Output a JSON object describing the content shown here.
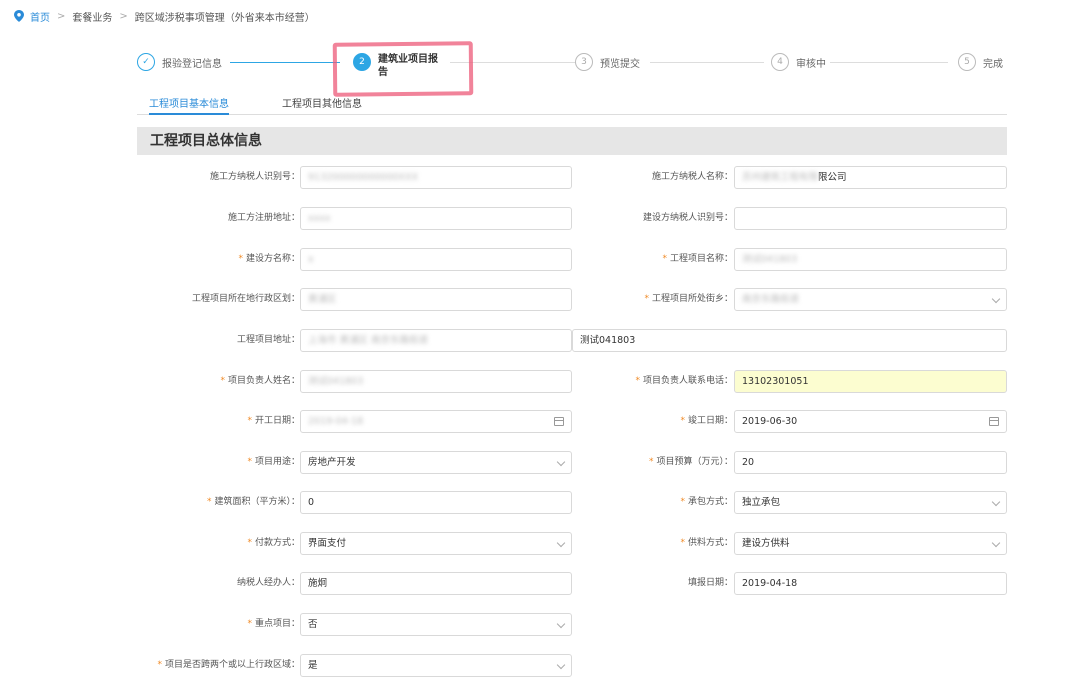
{
  "breadcrumb": {
    "items": [
      "首页",
      "套餐业务",
      "跨区域涉税事项管理（外省来本市经营）"
    ],
    "separator": ">"
  },
  "steps": [
    {
      "num": "✓",
      "label": "报验登记信息",
      "state": "done"
    },
    {
      "num": "2",
      "label": "建筑业项目报告",
      "state": "active"
    },
    {
      "num": "3",
      "label": "预览提交",
      "state": "pending"
    },
    {
      "num": "4",
      "label": "审核中",
      "state": "pending"
    },
    {
      "num": "5",
      "label": "完成",
      "state": "pending"
    }
  ],
  "tabs": [
    {
      "label": "工程项目基本信息",
      "active": true
    },
    {
      "label": "工程项目其他信息",
      "active": false
    }
  ],
  "section_title": "工程项目总体信息",
  "form": {
    "contractor_tax_id": {
      "label": "施工方纳税人识别号：",
      "value": "913200000000000XXX"
    },
    "contractor_name": {
      "label": "施工方纳税人名称：",
      "value_blur": "苏州建筑工程有限",
      "value_tail": "限公司"
    },
    "contractor_address": {
      "label": "施工方注册地址：",
      "value": "xxxx"
    },
    "builder_tax_id": {
      "label": "建设方纳税人识别号：",
      "value": ""
    },
    "builder_name": {
      "label": "建设方名称：",
      "value": "x"
    },
    "project_name": {
      "label": "工程项目名称：",
      "value": "测试041803"
    },
    "project_district": {
      "label": "工程项目所在地行政区划：",
      "value": "黄浦区"
    },
    "project_street": {
      "label": "工程项目所处街乡：",
      "value": "南京东路街道"
    },
    "project_address": {
      "label": "工程项目地址：",
      "value_blur": "上海市 黄浦区 南京东路街道",
      "value": "测试041803"
    },
    "manager_name": {
      "label": "项目负责人姓名：",
      "value": "测试041803"
    },
    "manager_phone": {
      "label": "项目负责人联系电话：",
      "value": "13102301051"
    },
    "start_date": {
      "label": "开工日期：",
      "value": "2019-04-18"
    },
    "end_date": {
      "label": "竣工日期：",
      "value": "2019-06-30"
    },
    "project_use": {
      "label": "项目用途：",
      "value": "房地产开发"
    },
    "project_budget": {
      "label": "项目预算（万元）：",
      "value": "20"
    },
    "building_area": {
      "label": "建筑面积（平方米）：",
      "value": "0"
    },
    "contract_method": {
      "label": "承包方式：",
      "value": "独立承包"
    },
    "payment_method": {
      "label": "付款方式：",
      "value": "界面支付"
    },
    "supply_method": {
      "label": "供料方式：",
      "value": "建设方供料"
    },
    "tax_agent": {
      "label": "纳税人经办人：",
      "value": "施炯"
    },
    "fill_date": {
      "label": "填报日期：",
      "value": "2019-04-18"
    },
    "key_project": {
      "label": "重点项目：",
      "value": "否"
    },
    "cross_region": {
      "label": "项目是否跨两个或以上行政区域：",
      "value": "是"
    }
  },
  "colors": {
    "accent": "#2da6e4",
    "link": "#2a8bd8",
    "required": "#f08a26",
    "highlight_field": "#fcfdd0",
    "annotation": "#ec5a78"
  }
}
